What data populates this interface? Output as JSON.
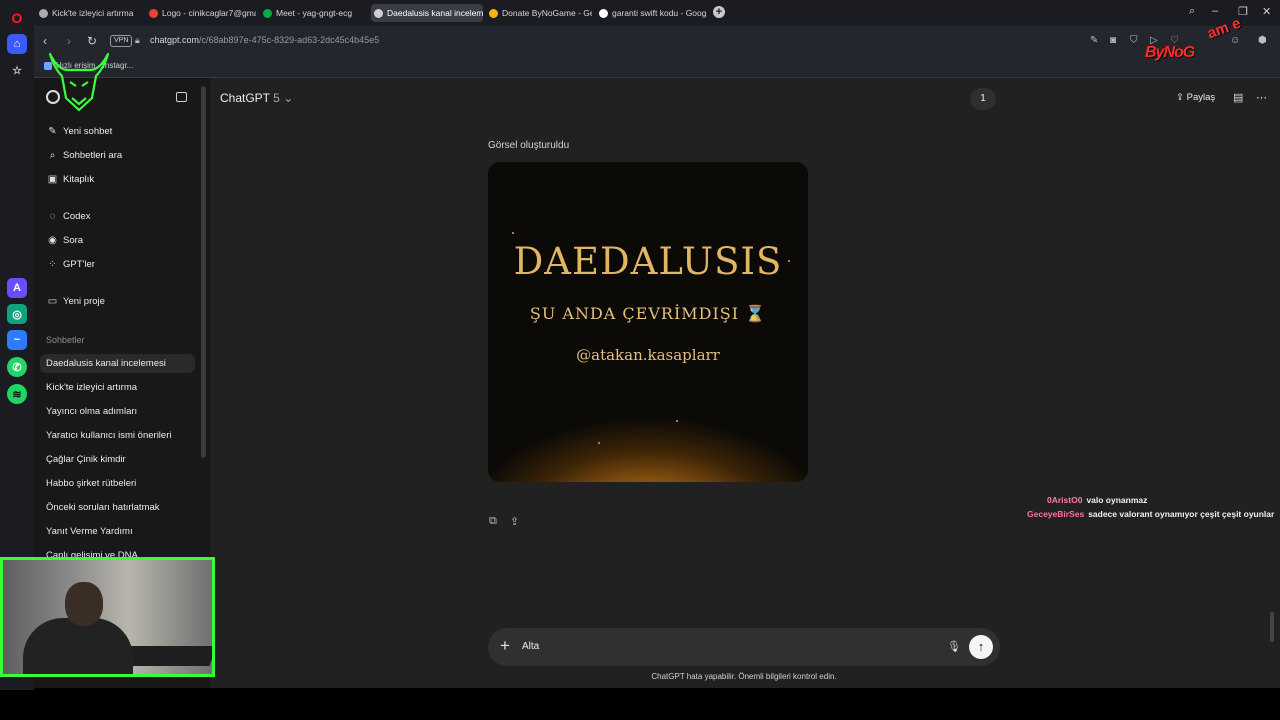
{
  "browser": {
    "tabs": [
      {
        "label": "Kick'te izleyici artırma"
      },
      {
        "label": "Logo - cinikcaglar7@gma"
      },
      {
        "label": "Meet - yag-gngt-ecg"
      },
      {
        "label": "Daedalusis kanal inceleme"
      },
      {
        "label": "Donate ByNoGame - Gele"
      },
      {
        "label": "garanti swift kodu - Goog"
      }
    ],
    "vpn_label": "VPN",
    "url_host": "chatgpt.com",
    "url_path": "/c/68ab897e-475c-8329-ad63-2dc45c4b45e5",
    "bookmark_label": "Hızlı erişim - Instagr..."
  },
  "sidebar": {
    "nav": [
      {
        "label": "Yeni sohbet",
        "icon": "edit-icon"
      },
      {
        "label": "Sohbetleri ara",
        "icon": "search-icon"
      },
      {
        "label": "Kitaplık",
        "icon": "library-icon"
      },
      {
        "label": "Codex",
        "icon": "codex-icon"
      },
      {
        "label": "Sora",
        "icon": "sora-icon"
      },
      {
        "label": "GPT'ler",
        "icon": "grid-icon"
      },
      {
        "label": "Yeni proje",
        "icon": "folder-icon"
      }
    ],
    "section_title": "Sohbetler",
    "chats": [
      "Daedalusis kanal incelemesi",
      "Kick'te izleyici artırma",
      "Yayıncı olma adımları",
      "Yaratıcı kullanıcı ismi önerileri",
      "Çağlar Çinik kimdir",
      "Habbo şirket rütbeleri",
      "Önceki soruları hatırlatmak",
      "Yanıt Verme Yardımı",
      "Canlı gelişimi ve DNA"
    ]
  },
  "header": {
    "model_name": "ChatGPT",
    "model_version": "5",
    "badge": "1",
    "share_label": "Paylaş"
  },
  "message": {
    "caption": "Görsel oluşturuldu",
    "image_line1": "DAEDALUSIS",
    "image_line2": "ŞU ANDA ÇEVRİMDIŞI",
    "image_line3": "@atakan.kasaplarr"
  },
  "stream_chat": [
    {
      "user": "0AristO0",
      "text": "valo oynanmaz",
      "user_color": "#ff7ca0"
    },
    {
      "user": "GeceyeBirSes",
      "text": "sadece valorant oynamıyor çeşit çeşit oyunlar",
      "user_color": "#ff6fa8"
    }
  ],
  "composer": {
    "text": "Alta",
    "disclaimer": "ChatGPT hata yapabilir. Önemli bilgileri kontrol edin."
  },
  "overlay": {
    "brand_text": "ByNoG",
    "brand_super": "am e"
  },
  "colors": {
    "webcam_border": "#39ff3a",
    "brand_red": "#ff2a2a",
    "gold_text": "#e1b564"
  }
}
